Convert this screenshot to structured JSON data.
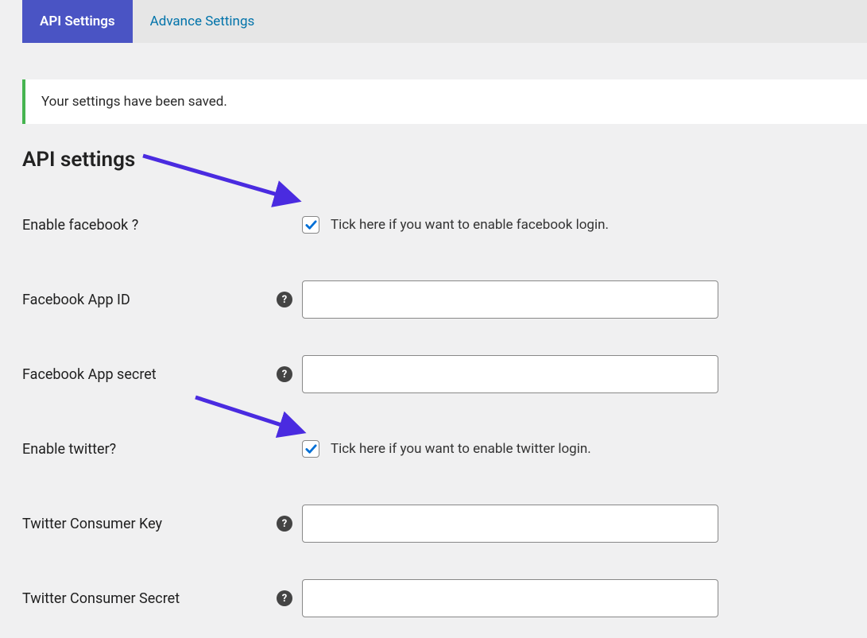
{
  "tabs": {
    "api": "API Settings",
    "advance": "Advance Settings"
  },
  "notice": "Your settings have been saved.",
  "heading": "API settings",
  "rows": {
    "enable_facebook": {
      "label": "Enable facebook ?",
      "hint": "Tick here if you want to enable facebook login.",
      "checked": true
    },
    "facebook_app_id": {
      "label": "Facebook App ID",
      "value": ""
    },
    "facebook_app_secret": {
      "label": "Facebook App secret",
      "value": ""
    },
    "enable_twitter": {
      "label": "Enable twitter?",
      "hint": "Tick here if you want to enable twitter login.",
      "checked": true
    },
    "twitter_consumer_key": {
      "label": "Twitter Consumer Key",
      "value": ""
    },
    "twitter_consumer_secret": {
      "label": "Twitter Consumer Secret",
      "value": ""
    }
  }
}
